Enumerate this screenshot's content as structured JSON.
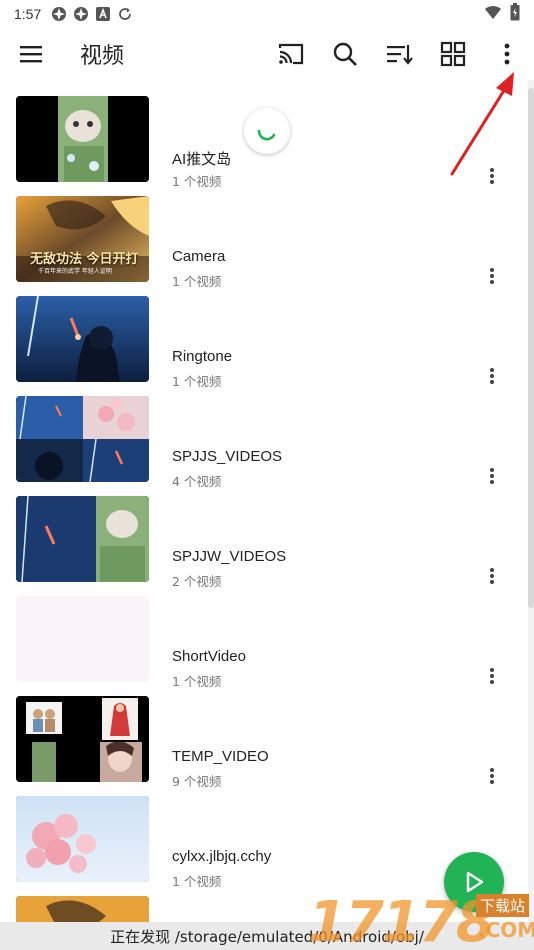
{
  "status_bar": {
    "time": "1:57",
    "icons": [
      "signal-app-icon",
      "signal-app-icon",
      "a-icon",
      "refresh-icon"
    ],
    "right_icons": [
      "wifi-icon",
      "battery-icon"
    ]
  },
  "toolbar": {
    "title": "视频",
    "actions": [
      "cast-icon",
      "search-icon",
      "sort-icon",
      "grid-view-icon",
      "more-vert-icon"
    ]
  },
  "folders": [
    {
      "name": "AI推文岛",
      "count": "1 个视频"
    },
    {
      "name": "Camera",
      "count": "1 个视频"
    },
    {
      "name": "Ringtone",
      "count": "1 个视频"
    },
    {
      "name": "SPJJS_VIDEOS",
      "count": "4 个视频"
    },
    {
      "name": "SPJJW_VIDEOS",
      "count": "2 个视频"
    },
    {
      "name": "ShortVideo",
      "count": "1 个视频"
    },
    {
      "name": "TEMP_VIDEO",
      "count": "9 个视频"
    },
    {
      "name": "cylxx.jlbjq.cchy",
      "count": "1 个视频"
    }
  ],
  "thumbnail_texts": {
    "camera_banner": "无敌功法 今日开打",
    "camera_sub": "千百年来的武学 年轻人证明"
  },
  "bottom_status": "正在发现 /storage/emulated/0/Android/obj/",
  "watermark": {
    "number": "17178",
    "dotcom": ".COM",
    "label": "下载站"
  },
  "colors": {
    "accent": "#22b357",
    "annotation_arrow": "#e02020",
    "text_primary": "#222222",
    "text_secondary": "#777777"
  }
}
